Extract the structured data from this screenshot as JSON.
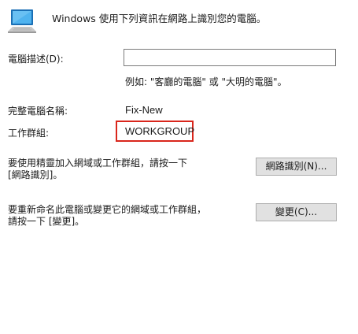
{
  "header": {
    "intro": "Windows 使用下列資訊在網路上識別您的電腦。",
    "icon": "computer-icon"
  },
  "form": {
    "description_label": "電腦描述(D):",
    "description_value": "",
    "example": "例如: \"客廳的電腦\" 或 \"大明的電腦\"。",
    "full_name_label": "完整電腦名稱:",
    "full_name_value": "Fix-New",
    "workgroup_label": "工作群組:",
    "workgroup_value": "WORKGROUP",
    "highlight_color": "#d9261c"
  },
  "network_id": {
    "text_line1": "要使用精靈加入網域或工作群組，請按一下",
    "text_line2": "[網路識別]。",
    "button_label": "網路識別(N)..."
  },
  "rename": {
    "text_line1": "要重新命名此電腦或變更它的網域或工作群組，",
    "text_line2": "請按一下 [變更]。",
    "button_label": "變更(C)..."
  }
}
